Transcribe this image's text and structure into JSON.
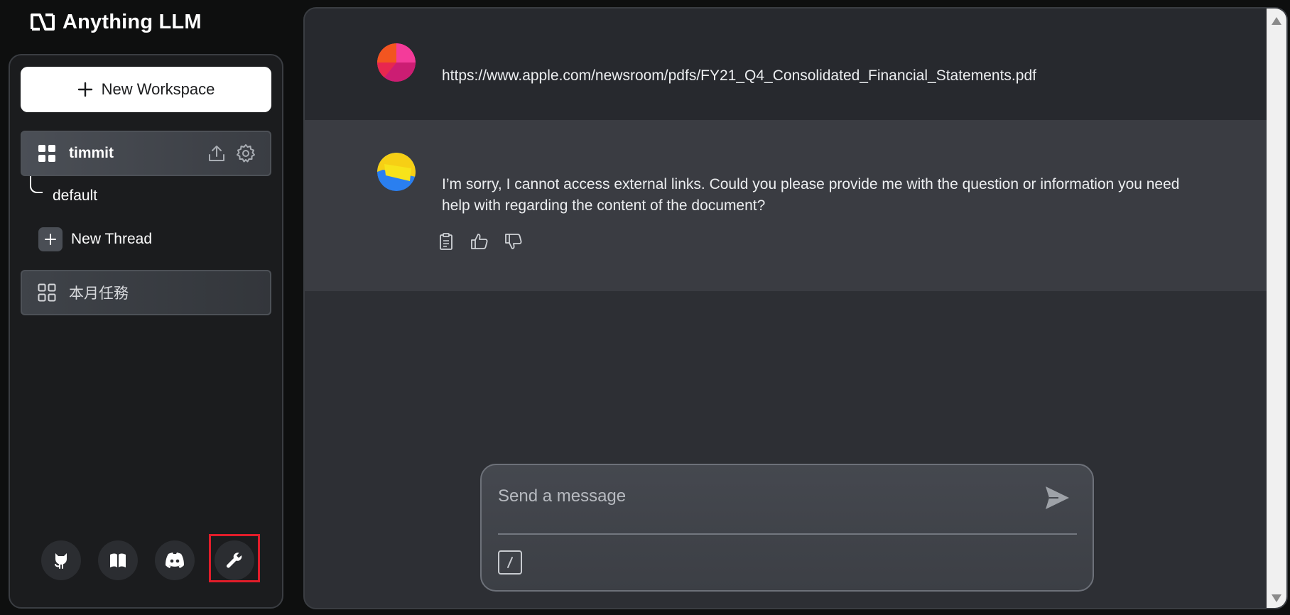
{
  "app": {
    "title": "Anything LLM"
  },
  "sidebar": {
    "new_workspace_label": "New Workspace",
    "workspaces": [
      {
        "name": "timmit",
        "active": true,
        "threads": [
          {
            "name": "default"
          }
        ]
      },
      {
        "name": "本月任務",
        "active": false
      }
    ],
    "new_thread_label": "New Thread",
    "footer_icons": [
      "github-icon",
      "docs-book-icon",
      "discord-icon",
      "settings-wrench-icon"
    ]
  },
  "chat": {
    "messages": [
      {
        "role": "user",
        "text": "https://www.apple.com/newsroom/pdfs/FY21_Q4_Consolidated_Financial_Statements.pdf"
      },
      {
        "role": "assistant",
        "text": "I’m sorry, I cannot access external links. Could you please provide me with the question or information you need help with regarding the content of the document?"
      }
    ],
    "message_actions": [
      "copy-icon",
      "thumbs-up-icon",
      "thumbs-down-icon"
    ]
  },
  "composer": {
    "placeholder": "Send a message"
  },
  "colors": {
    "background": "#0e0f0f",
    "panel": "#2d2f34",
    "assistant_bg": "#3a3c42",
    "user_bg": "#27292e",
    "highlight": "#e11d2a"
  }
}
